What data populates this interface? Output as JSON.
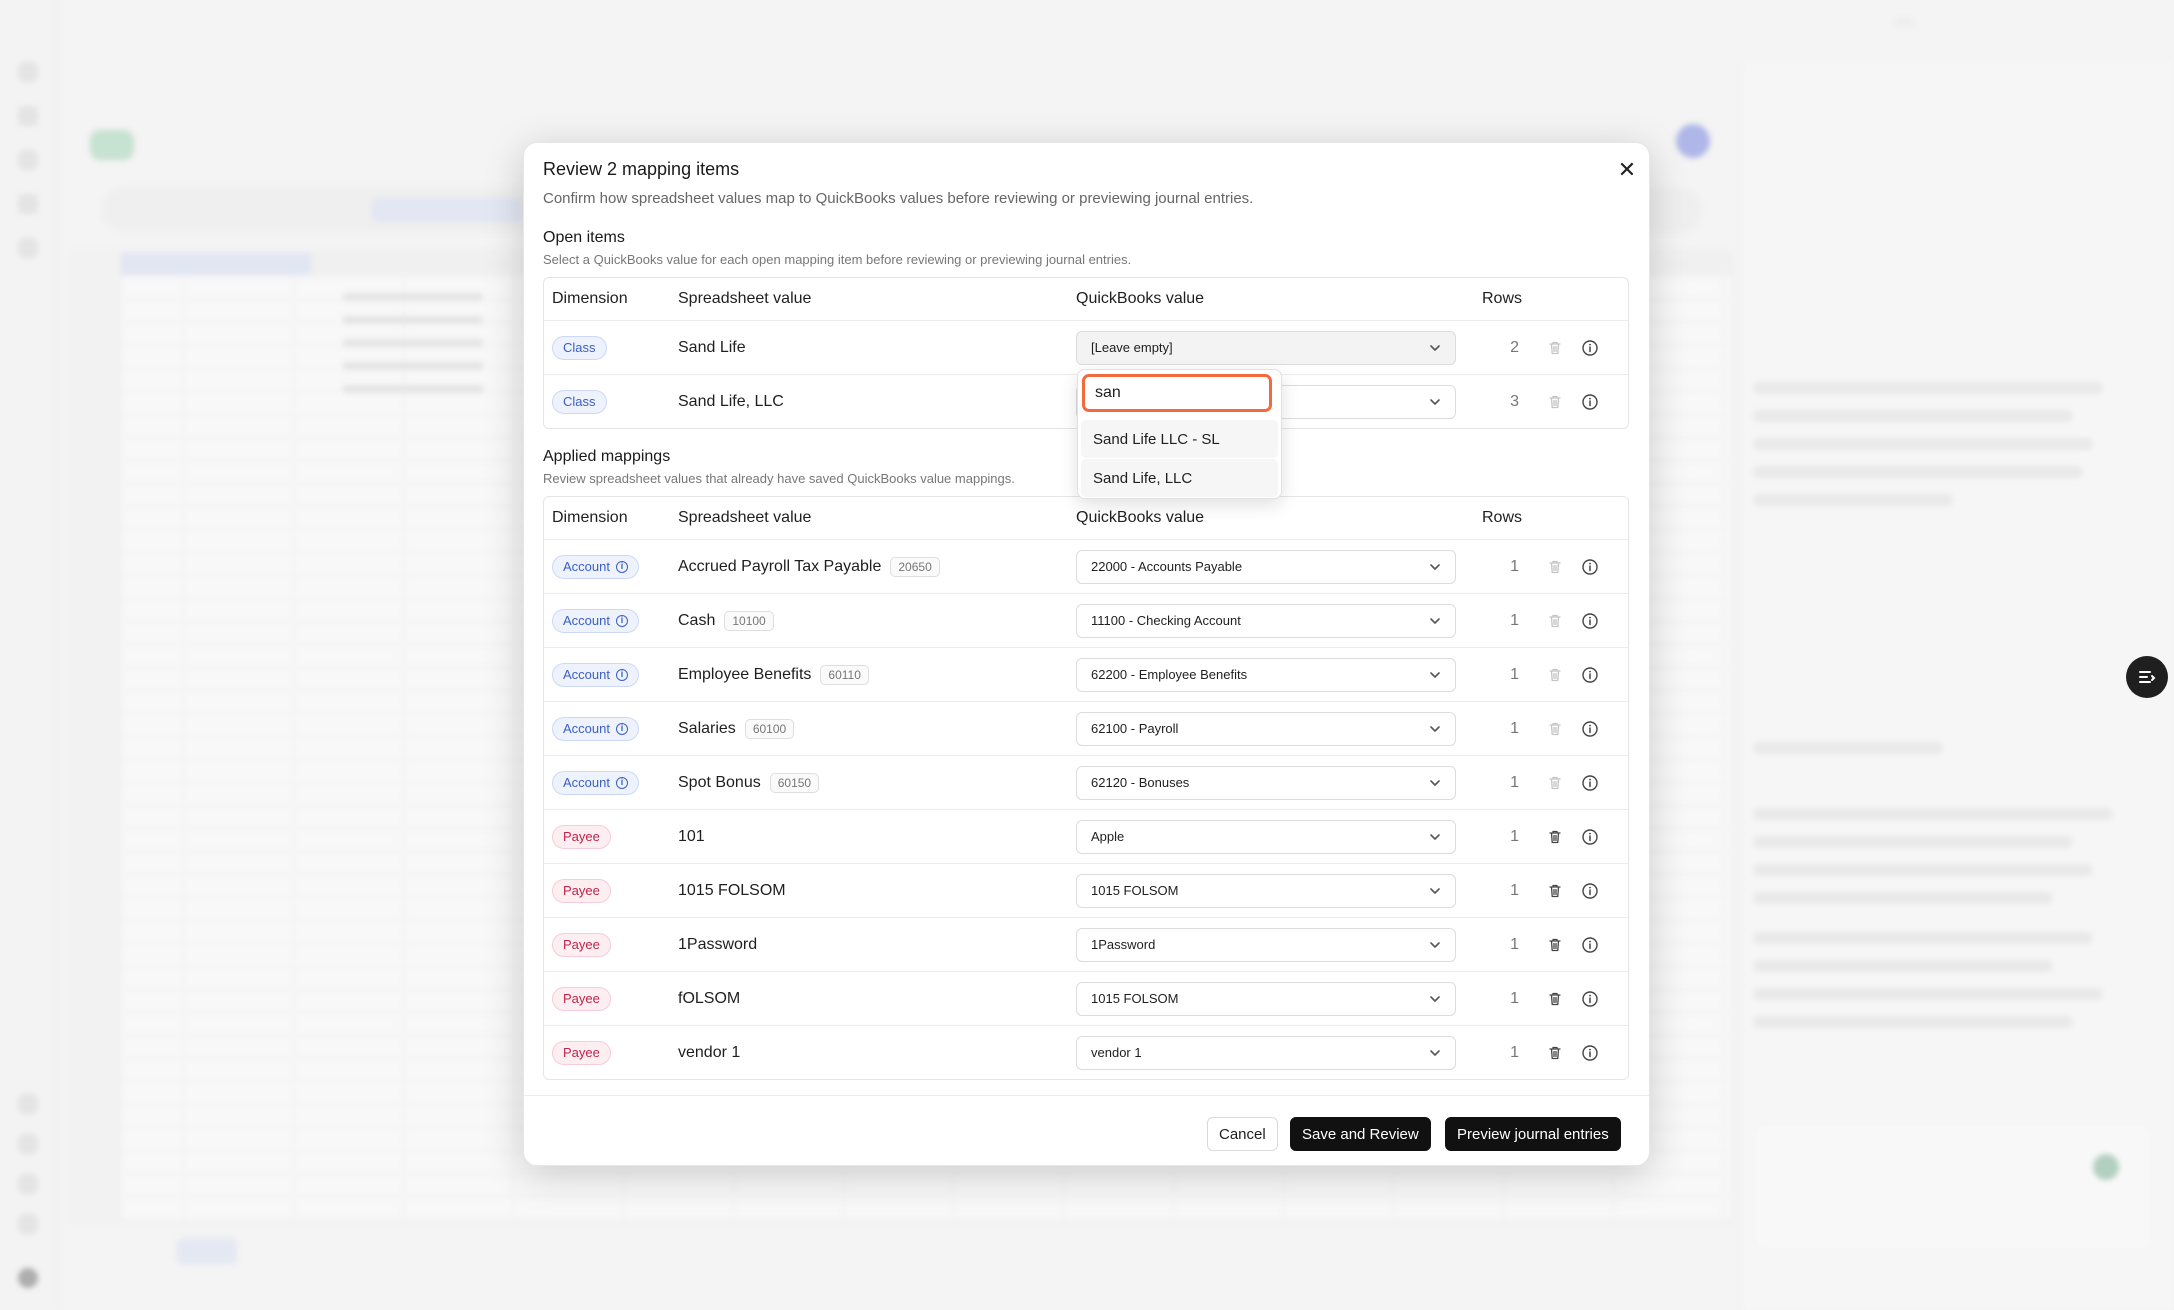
{
  "modal": {
    "title": "Review 2 mapping items",
    "subtitle": "Confirm how spreadsheet values map to QuickBooks values before reviewing or previewing journal entries.",
    "close_icon": "close-icon"
  },
  "open_items": {
    "title": "Open items",
    "description": "Select a QuickBooks value for each open mapping item before reviewing or previewing journal entries.",
    "columns": {
      "dimension": "Dimension",
      "spreadsheet": "Spreadsheet value",
      "quickbooks": "QuickBooks value",
      "rows": "Rows"
    },
    "rows": [
      {
        "dimension": "Class",
        "value": "Sand Life",
        "qb_value": "[Leave empty]",
        "rows": "2"
      },
      {
        "dimension": "Class",
        "value": "Sand Life, LLC",
        "qb_value": "",
        "rows": "3"
      }
    ]
  },
  "dropdown": {
    "search_value": "san",
    "options": [
      "Sand Life LLC - SL",
      "Sand Life, LLC"
    ]
  },
  "applied": {
    "title": "Applied mappings",
    "description": "Review spreadsheet values that already have saved QuickBooks value mappings.",
    "columns": {
      "dimension": "Dimension",
      "spreadsheet": "Spreadsheet value",
      "quickbooks": "QuickBooks value",
      "rows": "Rows"
    },
    "rows": [
      {
        "dimension": "Account",
        "value": "Accrued Payroll Tax Payable",
        "code": "20650",
        "qb_value": "22000 - Accounts Payable",
        "rows": "1"
      },
      {
        "dimension": "Account",
        "value": "Cash",
        "code": "10100",
        "qb_value": "11100 - Checking Account",
        "rows": "1"
      },
      {
        "dimension": "Account",
        "value": "Employee Benefits",
        "code": "60110",
        "qb_value": "62200 - Employee Benefits",
        "rows": "1"
      },
      {
        "dimension": "Account",
        "value": "Salaries",
        "code": "60100",
        "qb_value": "62100 - Payroll",
        "rows": "1"
      },
      {
        "dimension": "Account",
        "value": "Spot Bonus",
        "code": "60150",
        "qb_value": "62120 - Bonuses",
        "rows": "1"
      },
      {
        "dimension": "Payee",
        "value": "101",
        "code": "",
        "qb_value": "Apple",
        "rows": "1"
      },
      {
        "dimension": "Payee",
        "value": "1015 FOLSOM",
        "code": "",
        "qb_value": "1015 FOLSOM",
        "rows": "1"
      },
      {
        "dimension": "Payee",
        "value": "1Password",
        "code": "",
        "qb_value": "1Password",
        "rows": "1"
      },
      {
        "dimension": "Payee",
        "value": "fOLSOM",
        "code": "",
        "qb_value": "1015 FOLSOM",
        "rows": "1"
      },
      {
        "dimension": "Payee",
        "value": "vendor 1",
        "code": "",
        "qb_value": "vendor 1",
        "rows": "1"
      }
    ]
  },
  "footer": {
    "cancel": "Cancel",
    "save": "Save and Review",
    "preview": "Preview journal entries"
  },
  "colors": {
    "class_badge": "#3b5fc4",
    "account_badge": "#3b5fc4",
    "payee_badge": "#c0244b",
    "focus_ring": "#f26a3d",
    "primary_button": "#111111"
  }
}
